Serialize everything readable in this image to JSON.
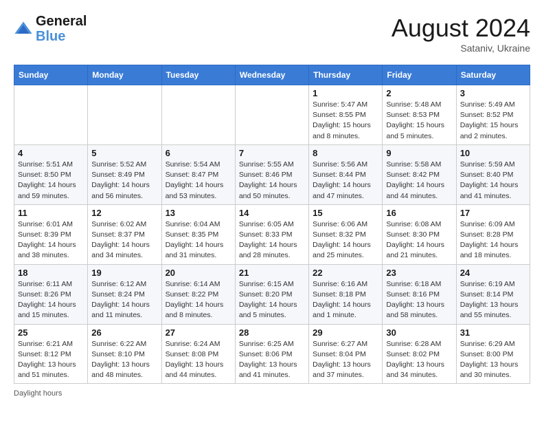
{
  "header": {
    "logo_line1": "General",
    "logo_line2": "Blue",
    "month": "August 2024",
    "location": "Sataniv, Ukraine"
  },
  "weekdays": [
    "Sunday",
    "Monday",
    "Tuesday",
    "Wednesday",
    "Thursday",
    "Friday",
    "Saturday"
  ],
  "weeks": [
    [
      {
        "day": "",
        "info": ""
      },
      {
        "day": "",
        "info": ""
      },
      {
        "day": "",
        "info": ""
      },
      {
        "day": "",
        "info": ""
      },
      {
        "day": "1",
        "info": "Sunrise: 5:47 AM\nSunset: 8:55 PM\nDaylight: 15 hours\nand 8 minutes."
      },
      {
        "day": "2",
        "info": "Sunrise: 5:48 AM\nSunset: 8:53 PM\nDaylight: 15 hours\nand 5 minutes."
      },
      {
        "day": "3",
        "info": "Sunrise: 5:49 AM\nSunset: 8:52 PM\nDaylight: 15 hours\nand 2 minutes."
      }
    ],
    [
      {
        "day": "4",
        "info": "Sunrise: 5:51 AM\nSunset: 8:50 PM\nDaylight: 14 hours\nand 59 minutes."
      },
      {
        "day": "5",
        "info": "Sunrise: 5:52 AM\nSunset: 8:49 PM\nDaylight: 14 hours\nand 56 minutes."
      },
      {
        "day": "6",
        "info": "Sunrise: 5:54 AM\nSunset: 8:47 PM\nDaylight: 14 hours\nand 53 minutes."
      },
      {
        "day": "7",
        "info": "Sunrise: 5:55 AM\nSunset: 8:46 PM\nDaylight: 14 hours\nand 50 minutes."
      },
      {
        "day": "8",
        "info": "Sunrise: 5:56 AM\nSunset: 8:44 PM\nDaylight: 14 hours\nand 47 minutes."
      },
      {
        "day": "9",
        "info": "Sunrise: 5:58 AM\nSunset: 8:42 PM\nDaylight: 14 hours\nand 44 minutes."
      },
      {
        "day": "10",
        "info": "Sunrise: 5:59 AM\nSunset: 8:40 PM\nDaylight: 14 hours\nand 41 minutes."
      }
    ],
    [
      {
        "day": "11",
        "info": "Sunrise: 6:01 AM\nSunset: 8:39 PM\nDaylight: 14 hours\nand 38 minutes."
      },
      {
        "day": "12",
        "info": "Sunrise: 6:02 AM\nSunset: 8:37 PM\nDaylight: 14 hours\nand 34 minutes."
      },
      {
        "day": "13",
        "info": "Sunrise: 6:04 AM\nSunset: 8:35 PM\nDaylight: 14 hours\nand 31 minutes."
      },
      {
        "day": "14",
        "info": "Sunrise: 6:05 AM\nSunset: 8:33 PM\nDaylight: 14 hours\nand 28 minutes."
      },
      {
        "day": "15",
        "info": "Sunrise: 6:06 AM\nSunset: 8:32 PM\nDaylight: 14 hours\nand 25 minutes."
      },
      {
        "day": "16",
        "info": "Sunrise: 6:08 AM\nSunset: 8:30 PM\nDaylight: 14 hours\nand 21 minutes."
      },
      {
        "day": "17",
        "info": "Sunrise: 6:09 AM\nSunset: 8:28 PM\nDaylight: 14 hours\nand 18 minutes."
      }
    ],
    [
      {
        "day": "18",
        "info": "Sunrise: 6:11 AM\nSunset: 8:26 PM\nDaylight: 14 hours\nand 15 minutes."
      },
      {
        "day": "19",
        "info": "Sunrise: 6:12 AM\nSunset: 8:24 PM\nDaylight: 14 hours\nand 11 minutes."
      },
      {
        "day": "20",
        "info": "Sunrise: 6:14 AM\nSunset: 8:22 PM\nDaylight: 14 hours\nand 8 minutes."
      },
      {
        "day": "21",
        "info": "Sunrise: 6:15 AM\nSunset: 8:20 PM\nDaylight: 14 hours\nand 5 minutes."
      },
      {
        "day": "22",
        "info": "Sunrise: 6:16 AM\nSunset: 8:18 PM\nDaylight: 14 hours\nand 1 minute."
      },
      {
        "day": "23",
        "info": "Sunrise: 6:18 AM\nSunset: 8:16 PM\nDaylight: 13 hours\nand 58 minutes."
      },
      {
        "day": "24",
        "info": "Sunrise: 6:19 AM\nSunset: 8:14 PM\nDaylight: 13 hours\nand 55 minutes."
      }
    ],
    [
      {
        "day": "25",
        "info": "Sunrise: 6:21 AM\nSunset: 8:12 PM\nDaylight: 13 hours\nand 51 minutes."
      },
      {
        "day": "26",
        "info": "Sunrise: 6:22 AM\nSunset: 8:10 PM\nDaylight: 13 hours\nand 48 minutes."
      },
      {
        "day": "27",
        "info": "Sunrise: 6:24 AM\nSunset: 8:08 PM\nDaylight: 13 hours\nand 44 minutes."
      },
      {
        "day": "28",
        "info": "Sunrise: 6:25 AM\nSunset: 8:06 PM\nDaylight: 13 hours\nand 41 minutes."
      },
      {
        "day": "29",
        "info": "Sunrise: 6:27 AM\nSunset: 8:04 PM\nDaylight: 13 hours\nand 37 minutes."
      },
      {
        "day": "30",
        "info": "Sunrise: 6:28 AM\nSunset: 8:02 PM\nDaylight: 13 hours\nand 34 minutes."
      },
      {
        "day": "31",
        "info": "Sunrise: 6:29 AM\nSunset: 8:00 PM\nDaylight: 13 hours\nand 30 minutes."
      }
    ]
  ],
  "footer": {
    "text": "Daylight hours"
  }
}
